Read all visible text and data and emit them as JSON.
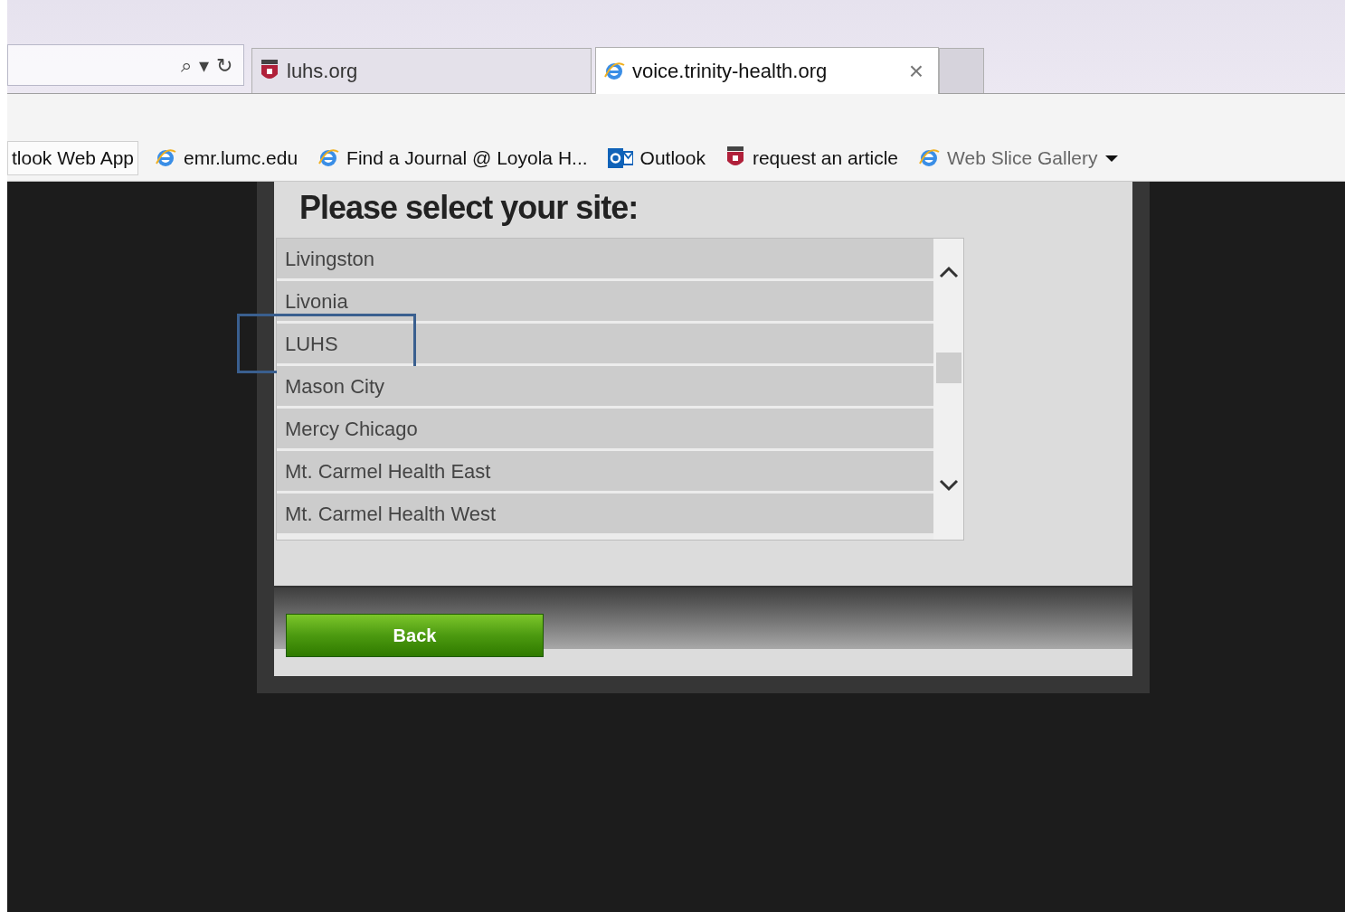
{
  "browser": {
    "address_controls": {
      "search": "⌕",
      "dropdown": "▾",
      "refresh": "↻"
    },
    "tabs": [
      {
        "label": "luhs.org",
        "kind": "shield",
        "selected": false
      },
      {
        "label": "voice.trinity-health.org",
        "kind": "ie",
        "selected": true,
        "close": "×"
      }
    ],
    "favorites": [
      {
        "label": "tlook Web App",
        "kind": "plain",
        "dimmed": false
      },
      {
        "label": "emr.lumc.edu",
        "kind": "ie",
        "dimmed": false
      },
      {
        "label": "Find a Journal @ Loyola H...",
        "kind": "ie",
        "dimmed": false
      },
      {
        "label": "Outlook",
        "kind": "outlook",
        "dimmed": false
      },
      {
        "label": "request an article",
        "kind": "shield",
        "dimmed": false
      },
      {
        "label": "Web Slice Gallery",
        "kind": "ie",
        "dimmed": true
      }
    ]
  },
  "dialog": {
    "heading": "Please select your site:",
    "sites": [
      {
        "label": "Livingston",
        "highlighted": false
      },
      {
        "label": "Livonia",
        "highlighted": false
      },
      {
        "label": "LUHS",
        "highlighted": true
      },
      {
        "label": "Mason City",
        "highlighted": false
      },
      {
        "label": "Mercy Chicago",
        "highlighted": false
      },
      {
        "label": "Mt. Carmel Health East",
        "highlighted": false
      },
      {
        "label": "Mt. Carmel Health West",
        "highlighted": false
      }
    ],
    "back_button": "Back"
  }
}
